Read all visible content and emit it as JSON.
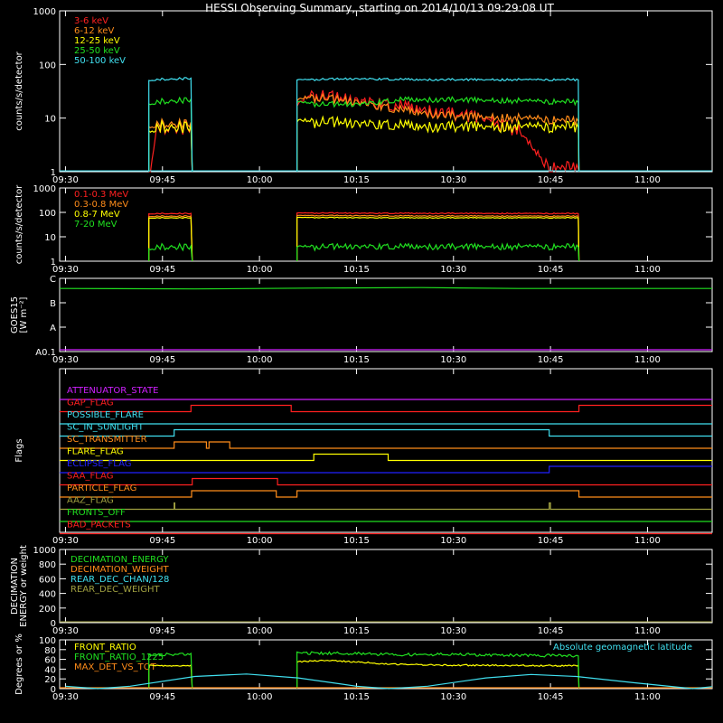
{
  "title": "HESSI Observing Summary, starting on 2014/10/13 09:29:08 UT",
  "x_ticks": [
    "09:30",
    "09:45",
    "10:00",
    "10:15",
    "10:30",
    "10:45",
    "11:00"
  ],
  "colors": {
    "red": "#ff2020",
    "orange": "#ff8c1a",
    "yellow": "#ffff00",
    "green": "#20e020",
    "cyan": "#40e0f0",
    "magenta": "#d020ff",
    "blue": "#2020ff",
    "olive": "#a0a040",
    "white": "#ffffff"
  },
  "chart_data": [
    {
      "type": "line",
      "id": "lightcurve",
      "ylabel": "counts/s/detector",
      "yscale": "log",
      "ylim": [
        1,
        1000
      ],
      "yticks": [
        "1",
        "10",
        "100",
        "1000"
      ],
      "legend": [
        "3-6 keV",
        "6-12 keV",
        "12-25 keV",
        "25-50 keV",
        "50-100 keV"
      ],
      "series_colors": [
        "red",
        "orange",
        "yellow",
        "green",
        "cyan"
      ],
      "time_units": "minutes since 09:30 UT",
      "xlim": [
        -0.9,
        50
      ],
      "intervals": [
        [
          12.9,
          19.6
        ],
        [
          35.8,
          79.4
        ]
      ],
      "series": [
        {
          "name": "3-6 keV",
          "points": [
            [
              13,
              1
            ],
            [
              14,
              7
            ],
            [
              19,
              7
            ],
            [
              36,
              18
            ],
            [
              38,
              28
            ],
            [
              44,
              22
            ],
            [
              50,
              18
            ],
            [
              60,
              12
            ],
            [
              65,
              10
            ],
            [
              70,
              6
            ],
            [
              73,
              2
            ],
            [
              75,
              1.2
            ]
          ]
        },
        {
          "name": "6-12 keV",
          "points": [
            [
              13,
              8
            ],
            [
              19,
              8
            ],
            [
              36,
              22
            ],
            [
              38,
              25
            ],
            [
              45,
              20
            ],
            [
              52,
              14
            ],
            [
              60,
              11
            ],
            [
              70,
              10
            ],
            [
              79,
              9
            ]
          ]
        },
        {
          "name": "12-25 keV",
          "points": [
            [
              13,
              7
            ],
            [
              19,
              7
            ],
            [
              36,
              9
            ],
            [
              45,
              8
            ],
            [
              55,
              7
            ],
            [
              65,
              7
            ],
            [
              79,
              7
            ]
          ]
        },
        {
          "name": "25-50 keV",
          "points": [
            [
              13,
              20
            ],
            [
              19,
              22
            ],
            [
              36,
              20
            ],
            [
              40,
              18
            ],
            [
              45,
              18
            ],
            [
              52,
              22
            ],
            [
              60,
              22
            ],
            [
              70,
              21
            ],
            [
              79,
              20
            ]
          ]
        },
        {
          "name": "50-100 keV",
          "points": [
            [
              13,
              52
            ],
            [
              19,
              55
            ],
            [
              36,
              52
            ],
            [
              45,
              54
            ],
            [
              55,
              52
            ],
            [
              65,
              52
            ],
            [
              79,
              52
            ]
          ]
        }
      ]
    },
    {
      "type": "line",
      "id": "highenergy",
      "ylabel": "counts/s/detector",
      "yscale": "log",
      "ylim": [
        1,
        1000
      ],
      "yticks": [
        "1",
        "10",
        "100",
        "1000"
      ],
      "legend": [
        "0.1-0.3 MeV",
        "0.3-0.8 MeV",
        "0.8-7 MeV",
        "7-20 MeV"
      ],
      "series_colors": [
        "red",
        "orange",
        "yellow",
        "green"
      ],
      "series": [
        {
          "name": "0.1-0.3 MeV",
          "points": [
            [
              13,
              90
            ],
            [
              19,
              90
            ],
            [
              36,
              95
            ],
            [
              50,
              92
            ],
            [
              79,
              90
            ]
          ]
        },
        {
          "name": "0.3-0.8 MeV",
          "points": [
            [
              13,
              70
            ],
            [
              19,
              70
            ],
            [
              36,
              75
            ],
            [
              50,
              72
            ],
            [
              79,
              70
            ]
          ]
        },
        {
          "name": "0.8-7 MeV",
          "points": [
            [
              13,
              60
            ],
            [
              19,
              60
            ],
            [
              36,
              62
            ],
            [
              50,
              60
            ],
            [
              79,
              60
            ]
          ]
        },
        {
          "name": "7-20 MeV",
          "points": [
            [
              13,
              4
            ],
            [
              19,
              4
            ],
            [
              36,
              4
            ],
            [
              50,
              4
            ],
            [
              79,
              4
            ]
          ]
        }
      ]
    },
    {
      "type": "line",
      "id": "goes",
      "ylabel_lines": [
        "GOES15",
        "[W m⁻²]"
      ],
      "yticks": [
        "A0.1",
        "A",
        "B",
        "C"
      ],
      "points": [
        [
          0,
          0.8
        ],
        [
          20,
          0.78
        ],
        [
          40,
          0.82
        ],
        [
          55,
          0.84
        ],
        [
          70,
          0.8
        ],
        [
          79,
          0.8
        ]
      ]
    },
    {
      "type": "line",
      "id": "flags",
      "ylabel": "Flags",
      "flags": [
        {
          "name": "ATTENUATOR_STATE",
          "color": "magenta",
          "transitions": []
        },
        {
          "name": "GAP_FLAG",
          "color": "red",
          "transitions": [
            [
              19.4,
              1
            ],
            [
              34.9,
              0
            ],
            [
              79.4,
              1
            ]
          ]
        },
        {
          "name": "POSSIBLE_FLARE",
          "color": "cyan",
          "transitions": []
        },
        {
          "name": "SC_IN_SUNLIGHT",
          "color": "cyan",
          "transitions": [
            [
              16.8,
              1
            ],
            [
              74.8,
              0
            ]
          ]
        },
        {
          "name": "SC_TRANSMITTER",
          "color": "orange",
          "transitions": [
            [
              16.8,
              1
            ],
            [
              21.8,
              0
            ],
            [
              22.2,
              1
            ],
            [
              25.4,
              0
            ]
          ]
        },
        {
          "name": "FLARE_FLAG",
          "color": "yellow",
          "transitions": [
            [
              38.4,
              1
            ],
            [
              49.9,
              0
            ]
          ]
        },
        {
          "name": "ECLIPSE_FLAG",
          "color": "blue",
          "transitions": [
            [
              16.8,
              0
            ],
            [
              74.8,
              1
            ]
          ]
        },
        {
          "name": "SAA_FLAG",
          "color": "red",
          "transitions": [
            [
              19.6,
              1
            ],
            [
              32.8,
              0
            ]
          ]
        },
        {
          "name": "PARTICLE_FLAG",
          "color": "orange",
          "transitions": [
            [
              19.5,
              1
            ],
            [
              32.6,
              0
            ],
            [
              35.8,
              1
            ],
            [
              79.4,
              0
            ]
          ]
        },
        {
          "name": "AAZ_FLAG",
          "color": "olive",
          "transitions": [
            [
              16.8,
              1
            ],
            [
              16.9,
              0
            ],
            [
              74.8,
              1
            ],
            [
              75,
              0
            ]
          ]
        },
        {
          "name": "FRONTS_OFF",
          "color": "green",
          "transitions": []
        },
        {
          "name": "BAD_PACKETS",
          "color": "red",
          "transitions": []
        }
      ]
    },
    {
      "type": "line",
      "id": "decimation",
      "ylabel_lines": [
        "DECIMATION",
        "ENERGY or weight"
      ],
      "yticks": [
        "0",
        "200",
        "400",
        "600",
        "800",
        "1000"
      ],
      "legend": [
        "DECIMATION_ENERGY",
        "DECIMATION_WEIGHT",
        "REAR_DEC_CHAN/128",
        "REAR_DEC_WEIGHT"
      ],
      "series_colors": [
        "green",
        "orange",
        "cyan",
        "olive"
      ]
    },
    {
      "type": "line",
      "id": "ratio",
      "ylabel": "Degrees or %",
      "yticks": [
        "0",
        "20",
        "40",
        "60",
        "80",
        "100"
      ],
      "legend": [
        "FRONT_RATIO",
        "FRONT_RATIO_1225",
        "MAX_DET_VS_TOT"
      ],
      "series_colors": [
        "yellow",
        "green",
        "orange"
      ],
      "right_label": "Absolute geomagnetic latitude",
      "series": [
        {
          "name": "FRONT_RATIO",
          "points": [
            [
              13,
              47
            ],
            [
              19,
              47
            ],
            [
              36,
              55
            ],
            [
              40,
              58
            ],
            [
              45,
              55
            ],
            [
              50,
              50
            ],
            [
              60,
              48
            ],
            [
              79,
              47
            ]
          ]
        },
        {
          "name": "FRONT_RATIO_1225",
          "points": [
            [
              13,
              70
            ],
            [
              19,
              70
            ],
            [
              36,
              73
            ],
            [
              45,
              72
            ],
            [
              50,
              70
            ],
            [
              60,
              70
            ],
            [
              79,
              67
            ]
          ]
        },
        {
          "name": "MAX_DET_VS_TOT",
          "points": [
            [
              0,
              0
            ],
            [
              79,
              0
            ]
          ]
        },
        {
          "name": "Absolute geomagnetic latitude",
          "points": [
            [
              0,
              5
            ],
            [
              5,
              0
            ],
            [
              10,
              5
            ],
            [
              20,
              25
            ],
            [
              28,
              30
            ],
            [
              36,
              22
            ],
            [
              45,
              5
            ],
            [
              50,
              0
            ],
            [
              56,
              5
            ],
            [
              65,
              22
            ],
            [
              72,
              29
            ],
            [
              79,
              25
            ],
            [
              88,
              12
            ],
            [
              97,
              0
            ],
            [
              100,
              4
            ]
          ]
        }
      ]
    }
  ]
}
